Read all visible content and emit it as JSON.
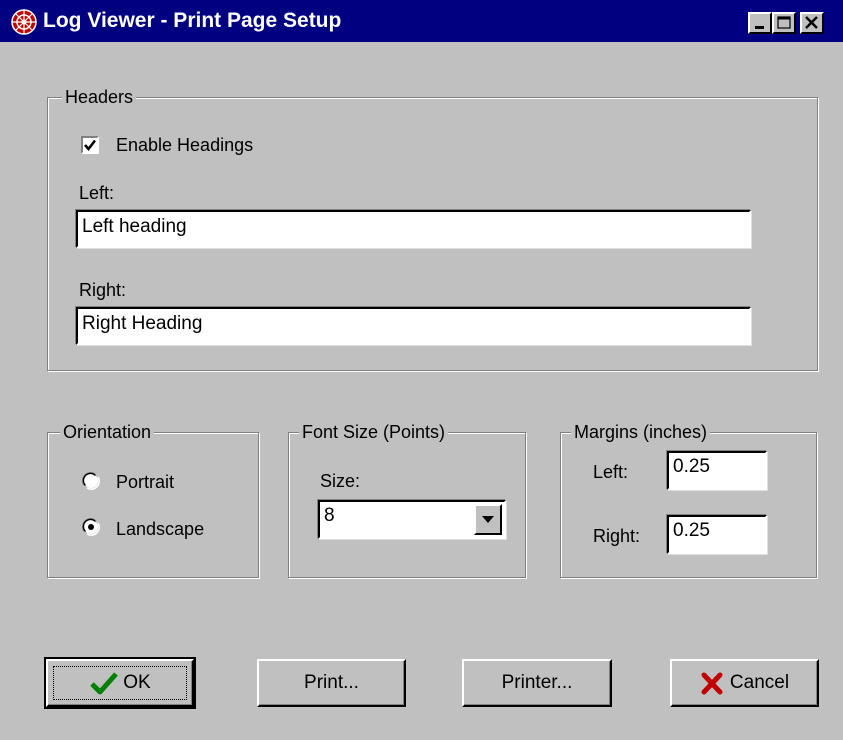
{
  "window": {
    "title": "Log Viewer - Print Page Setup",
    "app_icon": "log-viewer-app-icon",
    "controls": [
      "minimize-icon",
      "maximize-icon",
      "close-icon"
    ],
    "titlebar_color": "#000080"
  },
  "headers": {
    "legend": "Headers",
    "enable_label": "Enable Headings",
    "enable_checked": true,
    "left_label": "Left:",
    "left_value": "Left heading",
    "right_label": "Right:",
    "right_value": "Right Heading"
  },
  "orientation": {
    "legend": "Orientation",
    "options": [
      {
        "label": "Portrait",
        "selected": false
      },
      {
        "label": "Landscape",
        "selected": true
      }
    ]
  },
  "font_size": {
    "legend": "Font Size (Points)",
    "size_label": "Size:",
    "size_value": "8"
  },
  "margins": {
    "legend": "Margins (inches)",
    "left_label": "Left:",
    "left_value": "0.25",
    "right_label": "Right:",
    "right_value": "0.25"
  },
  "buttons": {
    "ok": "OK",
    "print": "Print...",
    "printer": "Printer...",
    "cancel": "Cancel",
    "ok_icon": "checkmark-icon",
    "cancel_icon": "x-icon",
    "ok_icon_color": "#008000",
    "cancel_icon_color": "#c00000"
  }
}
